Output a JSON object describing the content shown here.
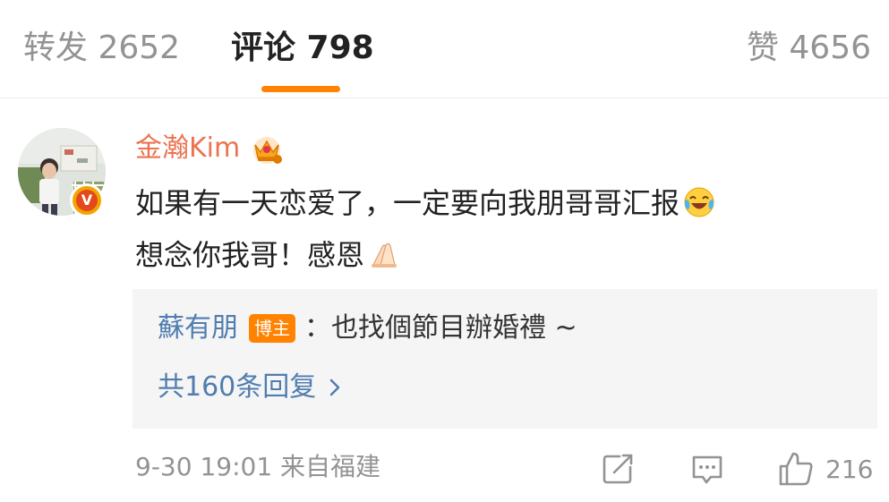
{
  "tabs": {
    "repost": "转发 2652",
    "comments": "评论 798",
    "likes": "赞 4656"
  },
  "comment": {
    "username": "金瀚Kim",
    "text_line1": "如果有一天恋爱了，一定要向我朋哥哥汇报",
    "text_line2": "想念你我哥！感恩",
    "reply": {
      "author": "蘇有朋",
      "badge": "博主",
      "text": "：也找個節目辦婚禮 ~"
    },
    "reply_count": "共160条回复",
    "timestamp": "9-30 19:01",
    "location": "来自福建",
    "like_count": "216"
  },
  "icons": {
    "verified": "verified-v-icon",
    "crown": "vip-crown-icon",
    "laugh": "laughing-crying-emoji",
    "pray": "folded-hands-emoji",
    "chevron": "chevron-right-icon",
    "repost": "repost-icon",
    "comment": "comment-icon",
    "like": "thumbs-up-icon"
  },
  "colors": {
    "accent": "#ff8200",
    "username": "#eb7350",
    "link": "#507daf",
    "muted": "#939393"
  }
}
